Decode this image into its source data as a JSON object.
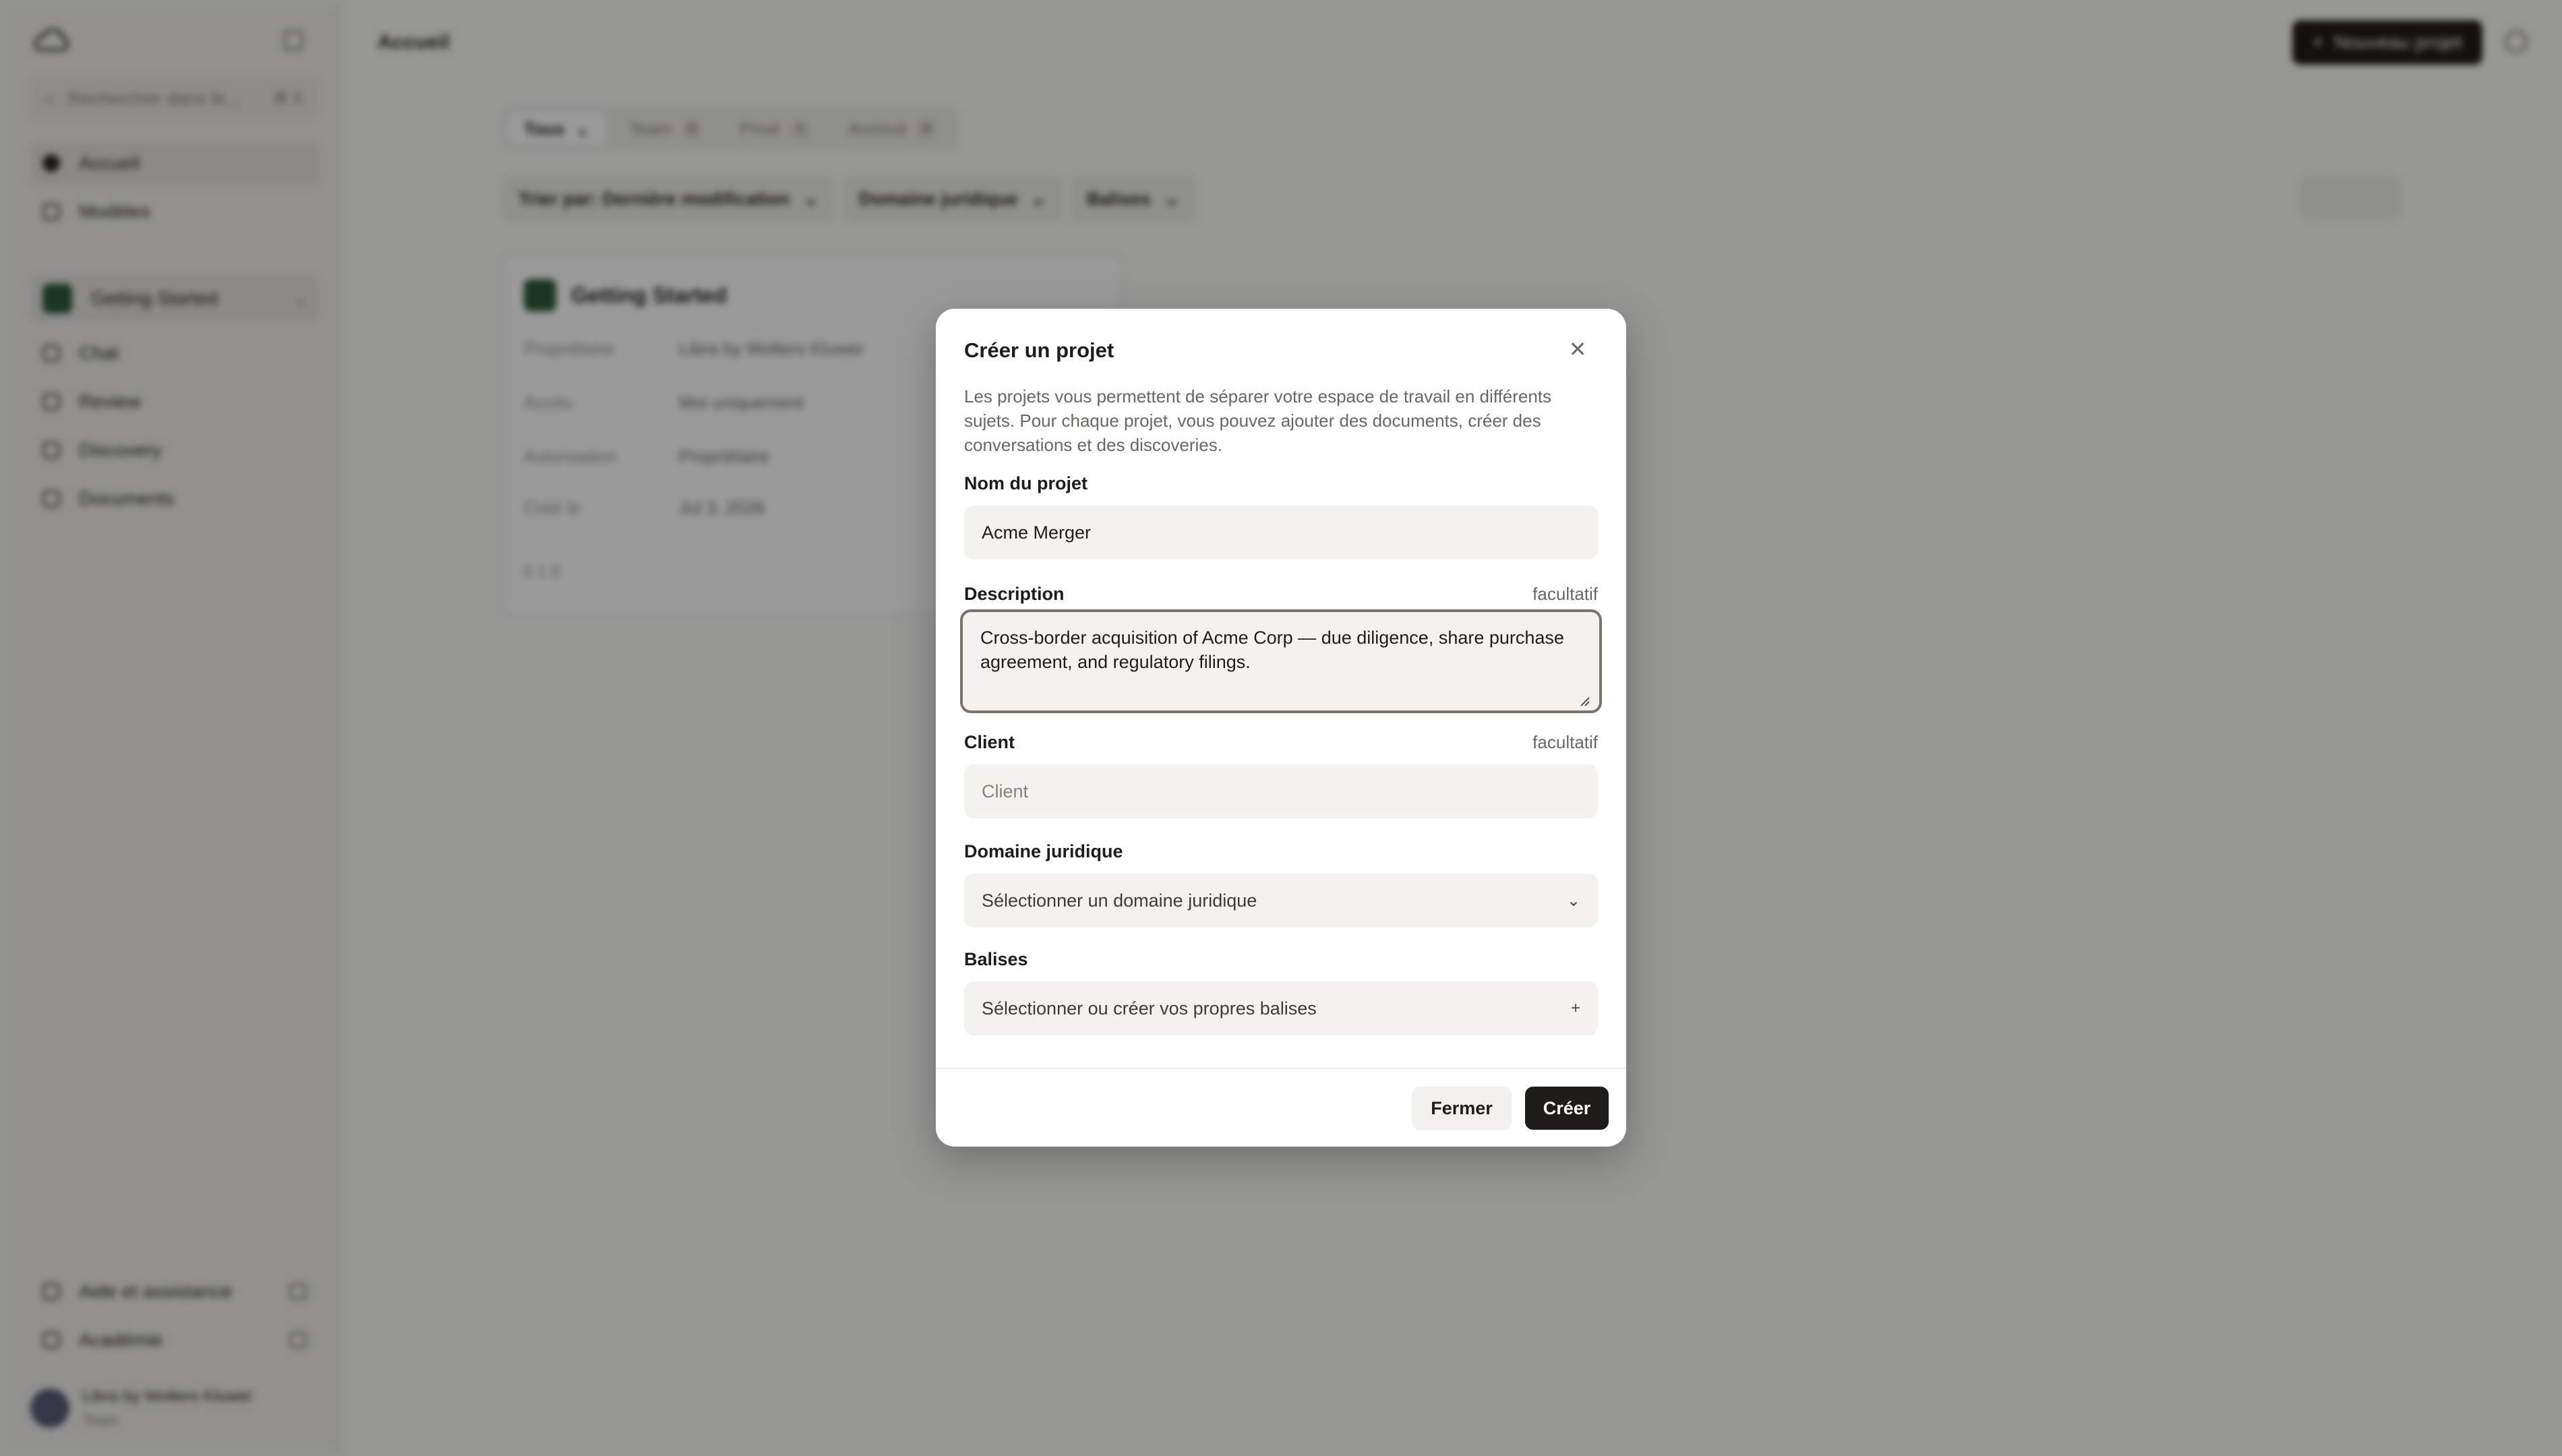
{
  "sidebar": {
    "search_placeholder": "Rechercher dans le...",
    "search_shortcut": "⌘ K",
    "nav": [
      {
        "label": "Accueil"
      },
      {
        "label": "Modèles"
      }
    ],
    "project": {
      "label": "Getting Started"
    },
    "project_nav": [
      {
        "label": "Chat"
      },
      {
        "label": "Review"
      },
      {
        "label": "Discovery"
      },
      {
        "label": "Documents"
      }
    ],
    "footer": [
      {
        "label": "Aide et assistance"
      },
      {
        "label": "Académie"
      }
    ],
    "user": {
      "name": "Libra by Wolters Kluwer",
      "role": "Team"
    }
  },
  "header": {
    "title": "Accueil",
    "new_project_label": "Nouveau projet"
  },
  "tabs": [
    {
      "label": "Tous",
      "count": ""
    },
    {
      "label": "Team",
      "count": "0"
    },
    {
      "label": "Privé",
      "count": "1"
    },
    {
      "label": "Archivé",
      "count": "0"
    }
  ],
  "filters": {
    "sort": "Trier par: Dernière modification",
    "domain": "Domaine juridique",
    "tags": "Balises"
  },
  "card": {
    "title": "Getting Started",
    "rows": [
      {
        "label": "Propriétaire",
        "value": "Libra by Wolters Kluwer"
      },
      {
        "label": "Accès",
        "value": "Moi uniquement"
      },
      {
        "label": "Autorisation",
        "value": "Propriétaire"
      },
      {
        "label": "Créé le",
        "value": "Jul 3, 2026"
      }
    ],
    "footer": "0   1   0"
  },
  "dialog": {
    "title": "Créer un projet",
    "description": "Les projets vous permettent de séparer votre espace de travail en différents sujets. Pour chaque projet, vous pouvez ajouter des documents, créer des conversations et des discoveries.",
    "project_name": {
      "label": "Nom du projet",
      "value": "Acme Merger"
    },
    "description_field": {
      "label": "Description",
      "optional": "facultatif",
      "value": "Cross-border acquisition of Acme Corp — due diligence, share purchase agreement, and regulatory filings."
    },
    "client": {
      "label": "Client",
      "optional": "facultatif",
      "placeholder": "Client"
    },
    "legal_domain": {
      "label": "Domaine juridique",
      "value": "Sélectionner un domaine juridique"
    },
    "tags": {
      "label": "Balises",
      "value": "Sélectionner ou créer vos propres balises"
    },
    "close_button": "Fermer",
    "create_button": "Créer"
  }
}
